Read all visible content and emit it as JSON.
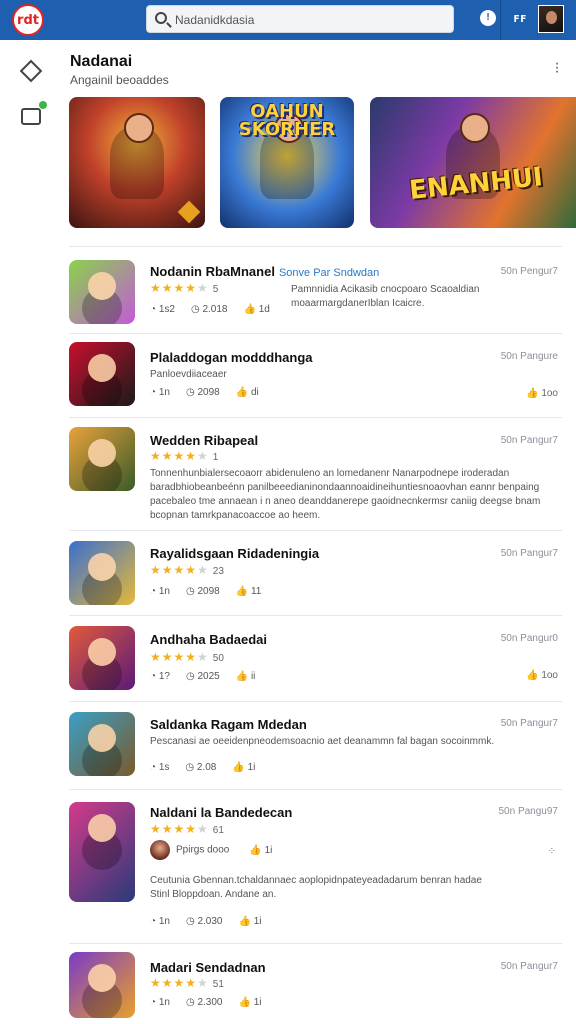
{
  "topbar": {
    "logo_text": "rdt",
    "search_value": "Nadanidkdasia",
    "search_placeholder": "Nadanidkdasia",
    "user_glyph": "ꜰꜰ"
  },
  "header": {
    "title": "Nadanai",
    "subtitle": "Angainil beoaddes"
  },
  "banners": [
    {
      "title": ""
    },
    {
      "title": "OAHUN SKORHER"
    },
    {
      "title": "ENANHUI"
    }
  ],
  "apps": [
    {
      "name": "Nodanin RbaMnanel",
      "link": "Sonve Par Sndwdan",
      "stars": 4,
      "rating_count": "5",
      "desc": "Pamnnidia Acikasib cnocpoaro Scaoaldian moaarmargdanerIblan Icaicre.",
      "comments": "1s2",
      "shares": "2.018",
      "likes": "1d",
      "price": "50n Pengur7",
      "colors": [
        "#8ad24a",
        "#c15bd8"
      ]
    },
    {
      "name": "Plaladdogan modddhanga",
      "stars": 0,
      "desc": "Panloevdiiaceaer",
      "comments": "1n",
      "shares": "2098",
      "likes": "di",
      "price": "50n Pangure",
      "like_right": "1oo",
      "colors": [
        "#c8102e",
        "#1a1a1a"
      ]
    },
    {
      "name": "Wedden Ribapeal",
      "stars": 4,
      "rating_count": "1",
      "desc": "Tonnenhunbialersecoaorr abidenuleno an lomedanenr Nanarpodnepe iroderadan baradbhiobeanbeénn panilbeeedianinondaannoaidineihuntiesnoaovhan eannr benpaing pacebaleo tme annaean i n aneo deanddanerepe gaoidnecnkermsr caniig deegse bnam bcopnan tamrkpanacoaccoe ao heem.",
      "price": "50n Pangur7",
      "colors": [
        "#e9a23b",
        "#3a5a2a"
      ]
    },
    {
      "name": "Rayalidsgaan Ridadeningia",
      "stars": 4,
      "rating_count": "23",
      "comments": "1n",
      "shares": "2098",
      "likes": "11",
      "price": "50n Pangur7",
      "colors": [
        "#3a6fcf",
        "#e6b93a"
      ]
    },
    {
      "name": "Andhaha Badaedai",
      "stars": 4,
      "rating_count": "50",
      "comments": "1?",
      "shares": "2025",
      "likes": "ii",
      "price": "50n Pangur0",
      "like_right": "1oo",
      "colors": [
        "#e25a3a",
        "#5a1a7a"
      ]
    },
    {
      "name": "Saldanka Ragam Mdedan",
      "desc": "Pescanasi ae oeeidenpneodemsoacnio aet deanammn fal bagan socoinmmk.",
      "comments": "1s",
      "shares": "2.08",
      "likes": "1i",
      "price": "50n Pangur7",
      "colors": [
        "#3aa0c8",
        "#7a5a2a"
      ]
    },
    {
      "name": "Naldani la Bandedecan",
      "stars": 4,
      "rating_count": "61",
      "reviewer": "Ppirgs dooo",
      "reviewer_likes": "1i",
      "desc": "Ceutunia Gbennan.tchaldannaec aoplopidnpateyeadadarum benran hadae Stinl Bloppdoan. Andane an.",
      "comments": "1n",
      "shares": "2.030",
      "likes": "1i",
      "price": "50n Pangu97",
      "colors": [
        "#d43a8a",
        "#2a3a7a"
      ]
    },
    {
      "name": "Madari Sendadnan",
      "stars": 4,
      "rating_count": "51",
      "comments": "1n",
      "shares": "2.300",
      "likes": "1i",
      "price": "50n Pangur7",
      "colors": [
        "#7a3ac8",
        "#e8a02a"
      ]
    }
  ]
}
